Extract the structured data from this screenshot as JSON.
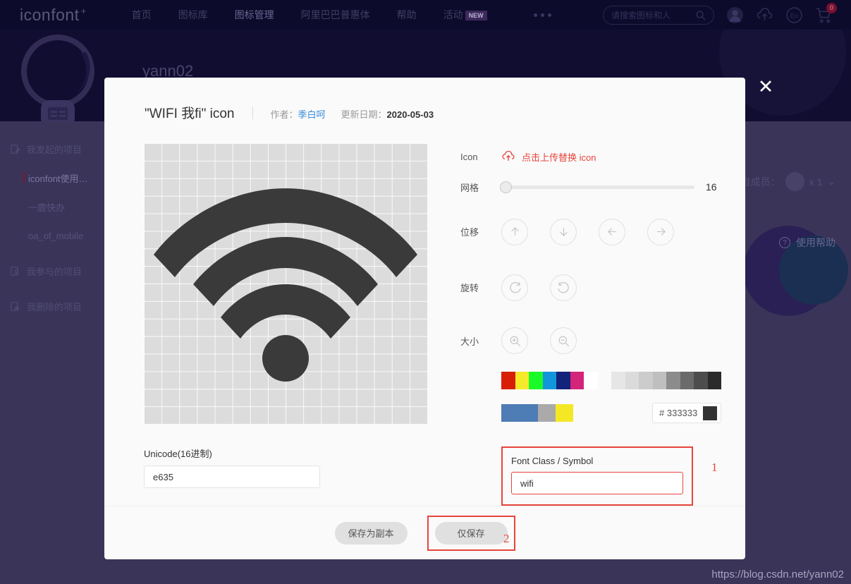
{
  "nav": {
    "brand": "iconfont",
    "brand_plus": "+",
    "links": [
      {
        "label": "首页",
        "active": false
      },
      {
        "label": "图标库",
        "active": false
      },
      {
        "label": "图标管理",
        "active": true
      },
      {
        "label": "阿里巴巴普惠体",
        "active": false
      },
      {
        "label": "帮助",
        "active": false
      },
      {
        "label": "活动",
        "active": false,
        "badge": "NEW"
      }
    ],
    "search_placeholder": "请搜索图标和人",
    "search_icon": "search-icon",
    "icons": [
      "avatar-icon",
      "upload-cloud-icon",
      "language-en-icon",
      "cart-icon"
    ],
    "cart_count": "0"
  },
  "hero": {
    "user": "yann02"
  },
  "sidebar": {
    "groups": [
      {
        "label": "我发起的项目",
        "items": [
          {
            "label": "iconfont使用…",
            "active": true
          },
          {
            "label": "一鹿快办",
            "active": false
          },
          {
            "label": "oa_of_mobile",
            "active": false
          }
        ]
      },
      {
        "label": "我参与的项目",
        "items": []
      },
      {
        "label": "我删除的项目",
        "items": []
      }
    ]
  },
  "page_meta": {
    "members_label": "项目成员：",
    "members_count": "x 1",
    "help_label": "使用帮助",
    "help_icon": "question-circle-icon"
  },
  "watermark": "https://blog.csdn.net/yann02",
  "modal": {
    "close_icon": "close-icon",
    "title": "\"WIFI 我fi\" icon",
    "author_label": "作者：",
    "author_name": "季白呵",
    "date_label": "更新日期：",
    "date_value": "2020-05-03",
    "canvas": {
      "grid_cells": 16,
      "icon_name": "wifi-icon",
      "icon_color": "#333333",
      "grid_line_color": "#fafafa",
      "grid_bg": "#dcdcdc"
    },
    "unicode": {
      "label": "Unicode(16进制)",
      "value": "e635"
    },
    "controls": {
      "icon_label": "Icon",
      "upload_text": "点击上传替换 icon",
      "upload_icon": "upload-cloud-icon",
      "upload_color": "#e8453c",
      "grid_label": "网格",
      "grid_value": "16",
      "move_label": "位移",
      "move_buttons": [
        "arrow-up-icon",
        "arrow-down-icon",
        "arrow-left-icon",
        "arrow-right-icon"
      ],
      "rotate_label": "旋转",
      "rotate_buttons": [
        "rotate-cw-icon",
        "rotate-ccw-icon"
      ],
      "size_label": "大小",
      "size_buttons": [
        "zoom-in-icon",
        "zoom-out-icon"
      ]
    },
    "palette": {
      "row1": [
        "#d81e06",
        "#f4ea2a",
        "#1afa29",
        "#1296db",
        "#13227a",
        "#d4237a",
        "#ffffff",
        "#e6e6e6",
        "#dbdbdb",
        "#cccccc",
        "#bfbfbf",
        "#8c8c8c",
        "#6b6b6b",
        "#4d4d4d",
        "#2b2b2b"
      ],
      "row2": [
        "#4e7cb5",
        "#aaaaaa",
        "#f4e825"
      ],
      "hex_prefix": "#",
      "hex_value": "333333",
      "hex_swatch": "#333333"
    },
    "font_class": {
      "label": "Font Class / Symbol",
      "value": "wifi",
      "highlight_color": "#e8453c"
    },
    "annotations": [
      {
        "num": "1"
      },
      {
        "num": "2"
      }
    ],
    "footer": {
      "save_copy_label": "保存为副本",
      "save_only_label": "仅保存"
    }
  }
}
